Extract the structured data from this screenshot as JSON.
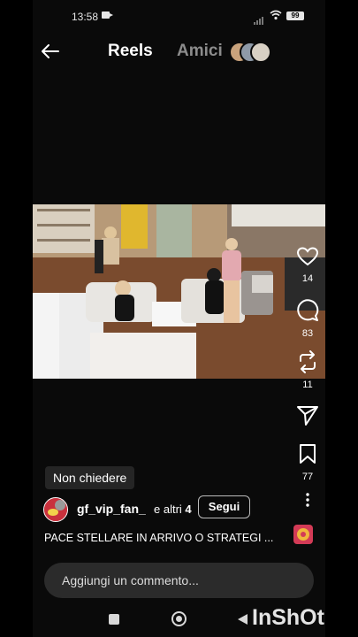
{
  "status_bar": {
    "time": "13:58",
    "battery": "99"
  },
  "header": {
    "tab_reels": "Reels",
    "tab_amici": "Amici"
  },
  "actions": {
    "likes": "14",
    "comments": "83",
    "reposts": "11",
    "saves": "77"
  },
  "tooltip": "Non chiedere",
  "post": {
    "author": "gf_vip_fan_",
    "extra_prefix": "e altri",
    "extra_count": "4",
    "follow_label": "Segui",
    "caption": "PACE STELLARE IN ARRIVO O STRATEGI ..."
  },
  "comment_placeholder": "Aggiungi un commento...",
  "watermark": "InShOt",
  "colors": {
    "background": "#0a0a0a",
    "inactive_tab": "#8c8c8c",
    "comment_bar": "#2b2b2b",
    "audio_thumb": "#d33b56"
  }
}
